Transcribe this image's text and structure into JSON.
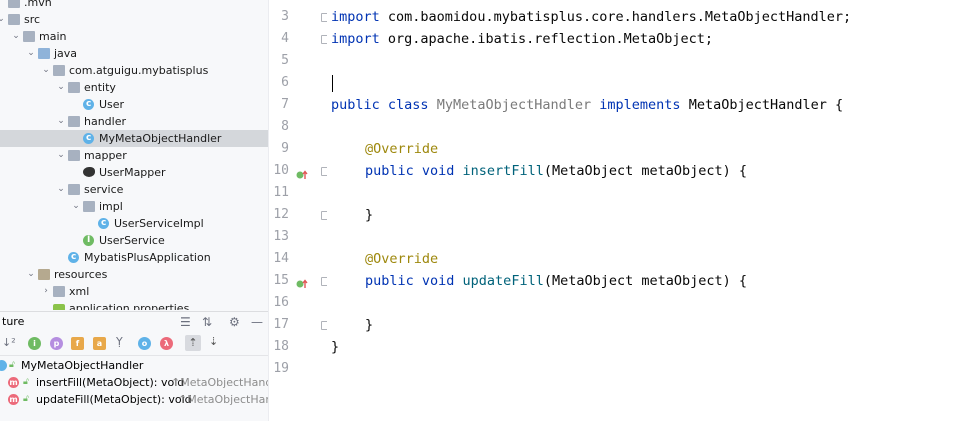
{
  "project_tree": {
    "items": [
      {
        "label": ".mvn",
        "kind": "folder",
        "depth": 0,
        "arrow": ""
      },
      {
        "label": "src",
        "kind": "folder",
        "depth": 0,
        "arrow": "v"
      },
      {
        "label": "main",
        "kind": "folder",
        "depth": 1,
        "arrow": "v"
      },
      {
        "label": "java",
        "kind": "folder-src",
        "depth": 2,
        "arrow": "v"
      },
      {
        "label": "com.atguigu.mybatisplus",
        "kind": "package",
        "depth": 3,
        "arrow": "v"
      },
      {
        "label": "entity",
        "kind": "package",
        "depth": 4,
        "arrow": "v"
      },
      {
        "label": "User",
        "kind": "class",
        "depth": 5,
        "arrow": ""
      },
      {
        "label": "handler",
        "kind": "package",
        "depth": 4,
        "arrow": "v"
      },
      {
        "label": "MyMetaObjectHandler",
        "kind": "class",
        "depth": 5,
        "arrow": "",
        "selected": true
      },
      {
        "label": "mapper",
        "kind": "package",
        "depth": 4,
        "arrow": "v"
      },
      {
        "label": "UserMapper",
        "kind": "mapper",
        "depth": 5,
        "arrow": ""
      },
      {
        "label": "service",
        "kind": "package",
        "depth": 4,
        "arrow": "v"
      },
      {
        "label": "impl",
        "kind": "package",
        "depth": 5,
        "arrow": "v"
      },
      {
        "label": "UserServiceImpl",
        "kind": "class",
        "depth": 6,
        "arrow": ""
      },
      {
        "label": "UserService",
        "kind": "interface",
        "depth": 5,
        "arrow": ""
      },
      {
        "label": "MybatisPlusApplication",
        "kind": "class",
        "depth": 4,
        "arrow": ""
      },
      {
        "label": "resources",
        "kind": "folder-res",
        "depth": 2,
        "arrow": "v"
      },
      {
        "label": "xml",
        "kind": "folder",
        "depth": 3,
        "arrow": ">"
      },
      {
        "label": "application.properties",
        "kind": "properties",
        "depth": 3,
        "arrow": ""
      }
    ]
  },
  "structure": {
    "title": "ture",
    "root": "MyMetaObjectHandler",
    "members": [
      {
        "name": "insertFill(MetaObject): void",
        "overrides": "↑MetaObjectHandle"
      },
      {
        "name": "updateFill(MetaObject): void",
        "overrides": "↑MetaObjectHand"
      }
    ],
    "toolbar_icons": [
      "sort-icon",
      "class-filter-icon",
      "property-icon",
      "field-icon",
      "lock-icon",
      "inherited-icon",
      "anonymous-icon",
      "lambda-icon",
      "scroll-from-source-icon",
      "scroll-to-source-icon"
    ]
  },
  "editor": {
    "line_numbers": [
      "3",
      "4",
      "5",
      "6",
      "7",
      "8",
      "9",
      "10",
      "11",
      "12",
      "13",
      "14",
      "15",
      "16",
      "17",
      "18",
      "19"
    ],
    "lines": {
      "l3_kw": "import",
      "l3_rest": " com.baomidou.mybatisplus.core.handlers.MetaObjectHandler;",
      "l4_kw": "import",
      "l4_rest": " org.apache.ibatis.reflection.MetaObject;",
      "l7_kw1": "public class",
      "l7_cls": "MyMetaObjectHandler",
      "l7_kw2": "implements",
      "l7_rest": "MetaObjectHandler {",
      "l9_ann": "@Override",
      "l10_kw": "public void",
      "l10_mn": "insertFill",
      "l10_rest": "(MetaObject metaObject) {",
      "l12": "}",
      "l14_ann": "@Override",
      "l15_kw": "public void",
      "l15_mn": "updateFill",
      "l15_rest": "(MetaObject metaObject) {",
      "l17": "}",
      "l18": "}"
    }
  }
}
